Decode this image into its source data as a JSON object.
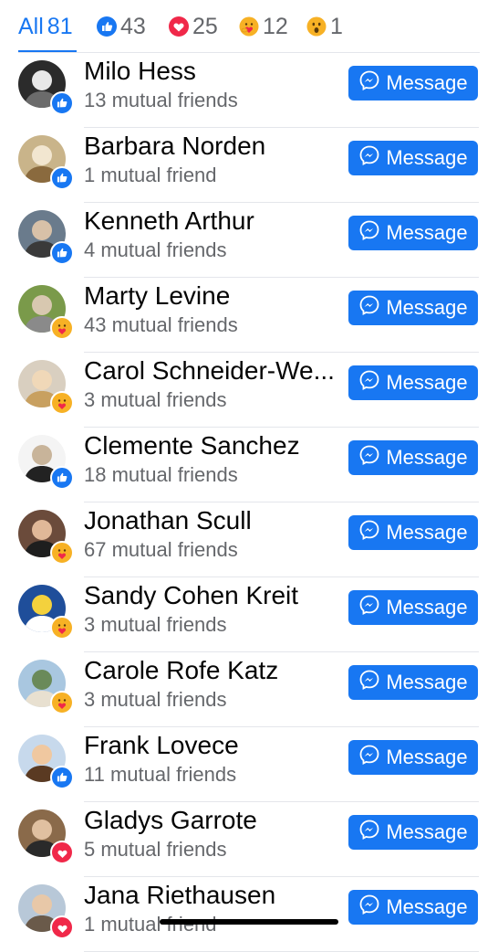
{
  "tabs": [
    {
      "label": "All",
      "count": "81",
      "icon": null
    },
    {
      "label": "",
      "count": "43",
      "icon": "like-icon"
    },
    {
      "label": "",
      "count": "25",
      "icon": "love-icon"
    },
    {
      "label": "",
      "count": "12",
      "icon": "care-icon"
    },
    {
      "label": "",
      "count": "1",
      "icon": "wow-icon"
    }
  ],
  "button_label": "Message",
  "people": [
    {
      "name": "Milo Hess",
      "mutual": "13 mutual friends",
      "reaction": "like"
    },
    {
      "name": "Barbara Norden",
      "mutual": "1 mutual friend",
      "reaction": "like"
    },
    {
      "name": "Kenneth Arthur",
      "mutual": "4 mutual friends",
      "reaction": "like"
    },
    {
      "name": "Marty Levine",
      "mutual": "43 mutual friends",
      "reaction": "care"
    },
    {
      "name": "Carol Schneider-We...",
      "mutual": "3 mutual friends",
      "reaction": "care"
    },
    {
      "name": "Clemente Sanchez",
      "mutual": "18 mutual friends",
      "reaction": "like"
    },
    {
      "name": "Jonathan Scull",
      "mutual": "67 mutual friends",
      "reaction": "care"
    },
    {
      "name": "Sandy Cohen Kreit",
      "mutual": "3 mutual friends",
      "reaction": "care"
    },
    {
      "name": "Carole Rofe Katz",
      "mutual": "3 mutual friends",
      "reaction": "care"
    },
    {
      "name": "Frank Lovece",
      "mutual": "11 mutual friends",
      "reaction": "like"
    },
    {
      "name": "Gladys Garrote",
      "mutual": "5 mutual friends",
      "reaction": "love"
    },
    {
      "name": "Jana Riethausen",
      "mutual": "1 mutual friend",
      "reaction": "love"
    }
  ],
  "colors": {
    "accent": "#1877f2",
    "love": "#f02849",
    "care": "#f7b125",
    "secondary_text": "#65676b"
  }
}
